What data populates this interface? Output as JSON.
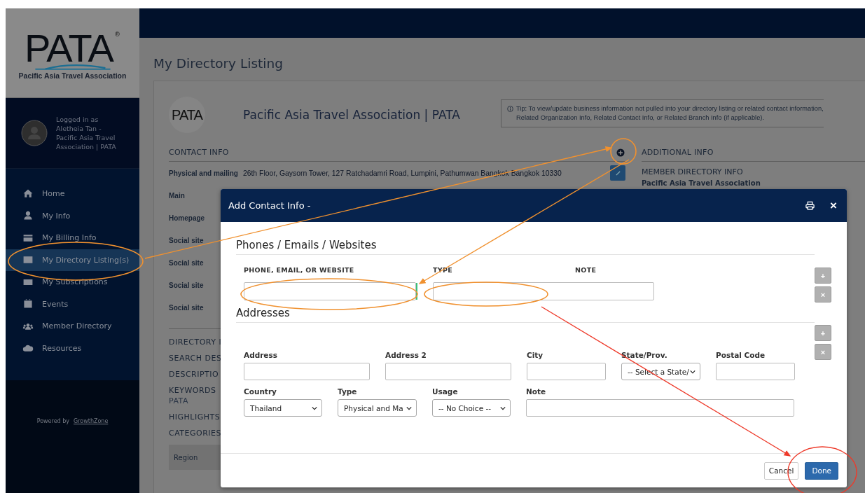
{
  "sidebar": {
    "logo": {
      "wordmark": "PATA",
      "registered": "®",
      "tagline": "Pacific Asia Travel Association"
    },
    "user": "Logged in as Aletheia Tan - Pacific Asia Travel Association | PATA",
    "nav": [
      {
        "label": "Home",
        "selected": false
      },
      {
        "label": "My Info",
        "selected": false
      },
      {
        "label": "My Billing Info",
        "selected": false
      },
      {
        "label": "My Directory Listing(s)",
        "selected": true
      },
      {
        "label": "My Subscriptions",
        "selected": false
      },
      {
        "label": "Events",
        "selected": false
      },
      {
        "label": "Member Directory",
        "selected": false
      },
      {
        "label": "Resources",
        "selected": false
      }
    ],
    "powered_by": "Powered by",
    "powered_link": "GrowthZone"
  },
  "page_title": "My Directory Listing",
  "card": {
    "logo_text": "PATA",
    "org_name": "Pacific Asia Travel Association | PATA",
    "tip": [
      "Tip: To view/update business information not pulled into your directory listing or related contact information,",
      "Related Organization Info, Related Contact Info, or Related Branch Info (if applicable)."
    ],
    "contact_heading": "CONTACT INFO",
    "contact_fields": [
      {
        "label": "Physical and mailing",
        "value": "26th Floor, Gaysorn Tower, 127 Ratchadamri Road, Lumpini, Pathumwan Bangkok Bangkok 10330"
      },
      {
        "label": "Main"
      },
      {
        "label": "Homepage"
      },
      {
        "label": "Social site"
      },
      {
        "label": "Social site"
      },
      {
        "label": "Social site"
      },
      {
        "label": "Social site"
      }
    ],
    "sections": [
      {
        "label": "DIRECTORY I"
      },
      {
        "label": "SEARCH DES"
      },
      {
        "label": "DESCRIPTIO"
      },
      {
        "label": "KEYWORDS",
        "value": "PATA"
      },
      {
        "label": "HIGHLIGHTS"
      },
      {
        "label": "CATEGORIES"
      }
    ],
    "region": "Region",
    "additional_heading": "ADDITIONAL INFO",
    "member_heading": "MEMBER DIRECTORY INFO",
    "member_org": "Pacific Asia Travel Association"
  },
  "modal": {
    "title": "Add Contact Info -",
    "close": "×",
    "phones_heading": "Phones / Emails / Websites",
    "phone_columns": [
      "PHONE, EMAIL, OR WEBSITE",
      "TYPE",
      "NOTE"
    ],
    "row_buttons": [
      "+",
      "×"
    ],
    "addresses_heading": "Addresses",
    "address_rows": [
      [
        {
          "label": "Address",
          "kind": "input"
        },
        {
          "label": "Address 2",
          "kind": "input"
        },
        {
          "label": "City",
          "kind": "input"
        },
        {
          "label": "State/Prov.",
          "kind": "select",
          "value": "-- Select a State/"
        },
        {
          "label": "Postal Code",
          "kind": "input"
        }
      ],
      [
        {
          "label": "Country",
          "kind": "select",
          "value": "Thailand"
        },
        {
          "label": "Type",
          "kind": "select",
          "value": "Physical and Ma"
        },
        {
          "label": "Usage",
          "kind": "select",
          "value": "-- No Choice --"
        },
        {
          "label": "Note",
          "kind": "input"
        }
      ]
    ],
    "address_buttons": [
      "+",
      "×"
    ],
    "cancel": "Cancel",
    "done": "Done"
  }
}
